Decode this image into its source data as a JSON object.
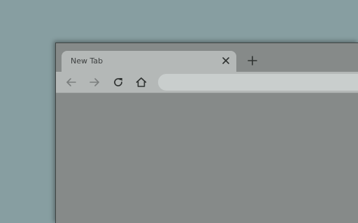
{
  "browser": {
    "tabs": [
      {
        "title": "New Tab",
        "active": true
      }
    ],
    "toolbar": {
      "omnibox_value": ""
    }
  },
  "icons": {
    "tab_close": "close-icon",
    "new_tab": "plus-icon",
    "back": "arrow-left-icon",
    "forward": "arrow-right-icon",
    "reload": "reload-icon",
    "home": "home-icon"
  },
  "colors": {
    "desktop": "#879ea1",
    "window_frame": "#868a89",
    "active_tab": "#b4b8b7",
    "omnibox": "#c9cecd",
    "icon_dark": "#2f3231",
    "icon_disabled": "#7b7f7e"
  }
}
